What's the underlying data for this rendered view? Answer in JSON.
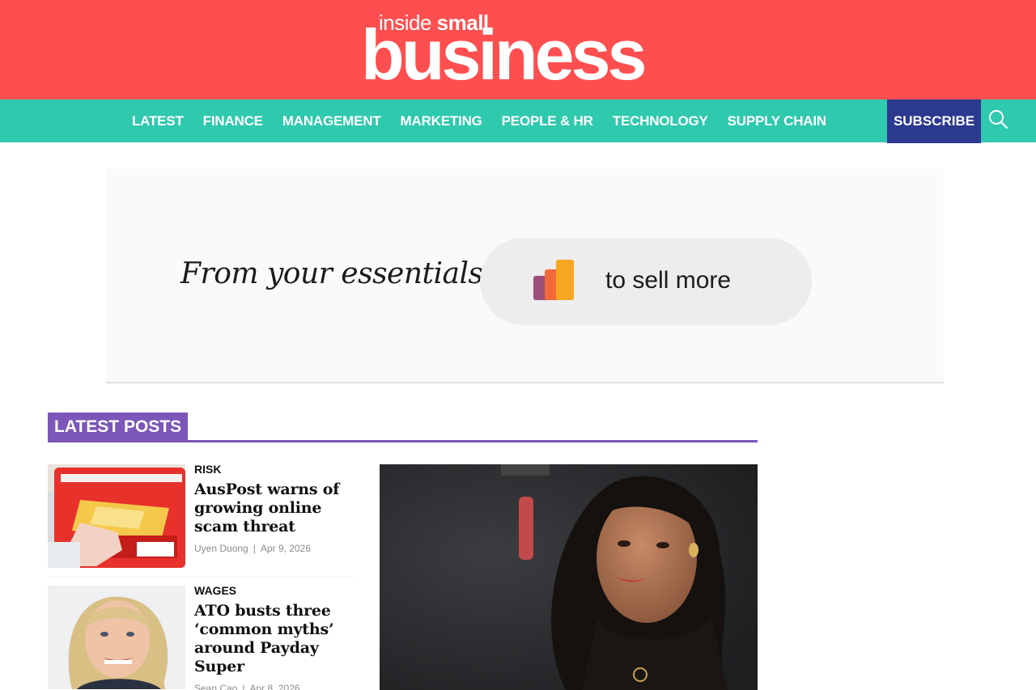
{
  "brand": {
    "logo_top_thin": "inside",
    "logo_top_bold": "small",
    "logo_main": "business",
    "color": "#fd4f4f"
  },
  "nav": {
    "items": [
      "LATEST",
      "FINANCE",
      "MANAGEMENT",
      "MARKETING",
      "PEOPLE & HR",
      "TECHNOLOGY",
      "SUPPLY CHAIN"
    ],
    "subscribe_label": "SUBSCRIBE",
    "search_icon": "search-icon",
    "color": "#2fc9ae",
    "subscribe_color": "#2b3a8f"
  },
  "ad": {
    "script_text": "From your essentials",
    "pill_text": "to sell more"
  },
  "latest": {
    "title": "LATEST POSTS",
    "color": "#7c56b9",
    "articles": [
      {
        "category": "RISK",
        "headline": "AusPost warns of growing online scam threat",
        "author": "Uyen Duong",
        "date": "Apr 9, 2026"
      },
      {
        "category": "WAGES",
        "headline": "ATO busts three ‘common myths’ around Payday Super",
        "author": "Sean Cao",
        "date": "Apr 8, 2026"
      }
    ]
  }
}
